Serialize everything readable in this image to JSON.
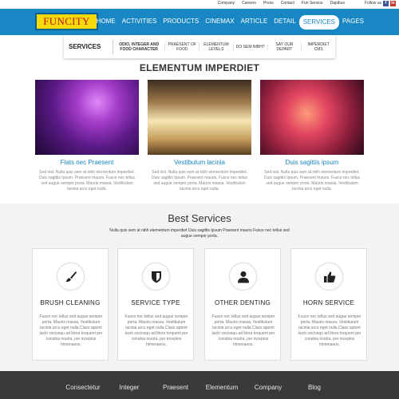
{
  "topbar": {
    "links": [
      "Company",
      "Careers",
      "Press",
      "Contact",
      "Fun Service",
      "Dapibus"
    ],
    "follow": "Follow us",
    "social": [
      "facebook-icon",
      "linkedin-icon"
    ]
  },
  "header": {
    "logo": "FUNCITY",
    "nav": [
      "HOME",
      "ACTIVITIES",
      "PRODUCTS",
      "CINEMAX",
      "ARTICLE",
      "DETAIL",
      "SERVICES",
      "PAGES"
    ],
    "active_nav": "SERVICES",
    "colors": {
      "brand_blue": "#1a87c5",
      "logo_yellow": "#f5d90b",
      "logo_red": "#c0150c"
    }
  },
  "dropdown": {
    "title": "SERVICES",
    "items": [
      "ODIO, INTEGER AND FOOD CHARACTER",
      "PRAESENT OF FOOD",
      "ELEMENTUM LEVELS",
      "DO SEM NIBH?",
      "SAY OUR DEPART",
      "IMPERDIET CMS"
    ]
  },
  "section": {
    "title": "ELEMENTUM IMPERDIET"
  },
  "photos": [
    {
      "caption": "Flats nec Praesent",
      "desc": "Sed nisl. Nulla quis sem at nibh elementum Imperdiet. Duis sagittis Ipsum. Praesent mauris. Fusce nec tellus sed augue semper porta. Mauris massa. Vestibulum lacinia arcu eget nulla."
    },
    {
      "caption": "Vestibulum lacinia",
      "desc": "Sed nisl. Nulla quis sem at nibh elementum Imperdiet. Duis sagittis Ipsum. Praesent mauris. Fusce nec tellus sed augue semper porta. Mauris massa. Vestibulum lacinia arcu eget nulla."
    },
    {
      "caption": "Duis sagittis ipsum",
      "desc": "Sed nisl. Nulla quis sem at nibh elementum Imperdiet. Duis sagittis Ipsum. Praesent mauris. Fusce nec tellus sed augue semper porta. Mauris massa. Vestibulum lacinia arcu eget nulla."
    }
  ],
  "best_services": {
    "title": "Best Services",
    "subtitle": "Nulla quis sem at nibh elementum imperdiet Duis sagittis Ipsum Praesent mauris Fusce nec tellus sed augue semper porta.",
    "cards": [
      {
        "name": "BRUSH CLEANING",
        "icon": "brush-icon",
        "desc": "Fusce nec tellus sed augue semper porta. Mauris massa. Vestibulum lacinia arcu eget nulla.Class aptent taciti sociosqu ad litora torquent per conubia nostra, per inceptos himenaeos."
      },
      {
        "name": "SERVICE TYPE",
        "icon": "shield-icon",
        "desc": "Fusce nec tellus sed augue semper porta. Mauris massa. Vestibulum lacinia arcu eget nulla.Class aptent taciti sociosqu ad litora torquent per conubia nostra, per inceptos himenaeos."
      },
      {
        "name": "OTHER DENTING",
        "icon": "user-icon",
        "desc": "Fusce nec tellus sed augue semper porta. Mauris massa. Vestibulum lacinia arcu eget nulla.Class aptent taciti sociosqu ad litora torquent per conubia nostra, per inceptos himenaeos."
      },
      {
        "name": "HORN SERVICE",
        "icon": "thumbs-up-icon",
        "desc": "Fusce nec tellus sed augue semper porta. Mauris massa. Vestibulum lacinia arcu eget nulla.Class aptent taciti sociosqu ad litora torquent per conubia nostra, per inceptos himenaeos."
      }
    ]
  },
  "footer": {
    "nav": [
      "Consectetur",
      "Integer",
      "Praesent",
      "Elementum",
      "Company",
      "Blog"
    ]
  }
}
